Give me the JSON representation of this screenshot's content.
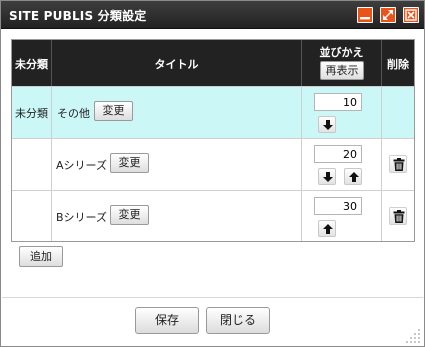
{
  "window": {
    "title": "SITE PUBLIS 分類設定",
    "controls": [
      "minimize-icon",
      "maximize-icon",
      "close-icon"
    ],
    "accent_color": "#e8541a"
  },
  "table": {
    "headers": {
      "uncategorized": "未分類",
      "title": "タイトル",
      "sort": "並びかえ",
      "redisplay": "再表示",
      "delete": "削除"
    },
    "rows": [
      {
        "uncategorized": "未分類",
        "name": "その他",
        "change": "変更",
        "order": "10",
        "arrows": [
          "down"
        ],
        "deletable": false,
        "highlight": "#ccf7f7"
      },
      {
        "uncategorized": "",
        "name": "Aシリーズ",
        "change": "変更",
        "order": "20",
        "arrows": [
          "down",
          "up"
        ],
        "deletable": true
      },
      {
        "uncategorized": "",
        "name": "Bシリーズ",
        "change": "変更",
        "order": "30",
        "arrows": [
          "up"
        ],
        "deletable": true
      }
    ]
  },
  "actions": {
    "add": "追加",
    "save": "保存",
    "close": "閉じる"
  }
}
